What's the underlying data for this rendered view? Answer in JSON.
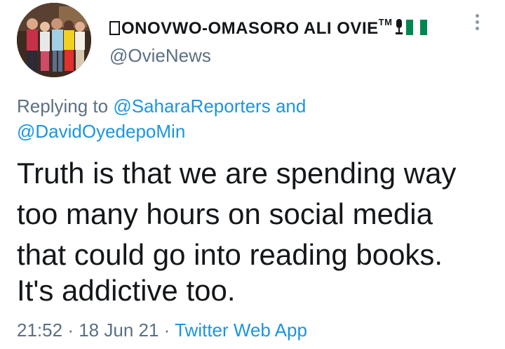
{
  "author": {
    "display_name": "onovwo-omasoro ali ovie",
    "trademark": "TM",
    "handle": "@OvieNews",
    "avatar_icon": "group-photo-avatar",
    "flag_icon": "nigeria-flag-icon",
    "flag_colors": [
      "#008751",
      "#ffffff",
      "#008751"
    ]
  },
  "reply": {
    "prefix": "Replying to",
    "mention1": "@SaharaReporters",
    "conjunction": "and",
    "mention2": "@DavidOyedepoMin"
  },
  "tweet": {
    "line1": "Truth is that we are spending way",
    "line2": "too many hours on social media",
    "line3": "that could go into reading books.",
    "line4": "It's addictive too."
  },
  "meta": {
    "time": "21:52",
    "separator": "·",
    "date": "18 Jun 21",
    "source": "Twitter Web App"
  },
  "colors": {
    "text": "#14171a",
    "secondary": "#5b7083",
    "link": "#1b95e0"
  }
}
